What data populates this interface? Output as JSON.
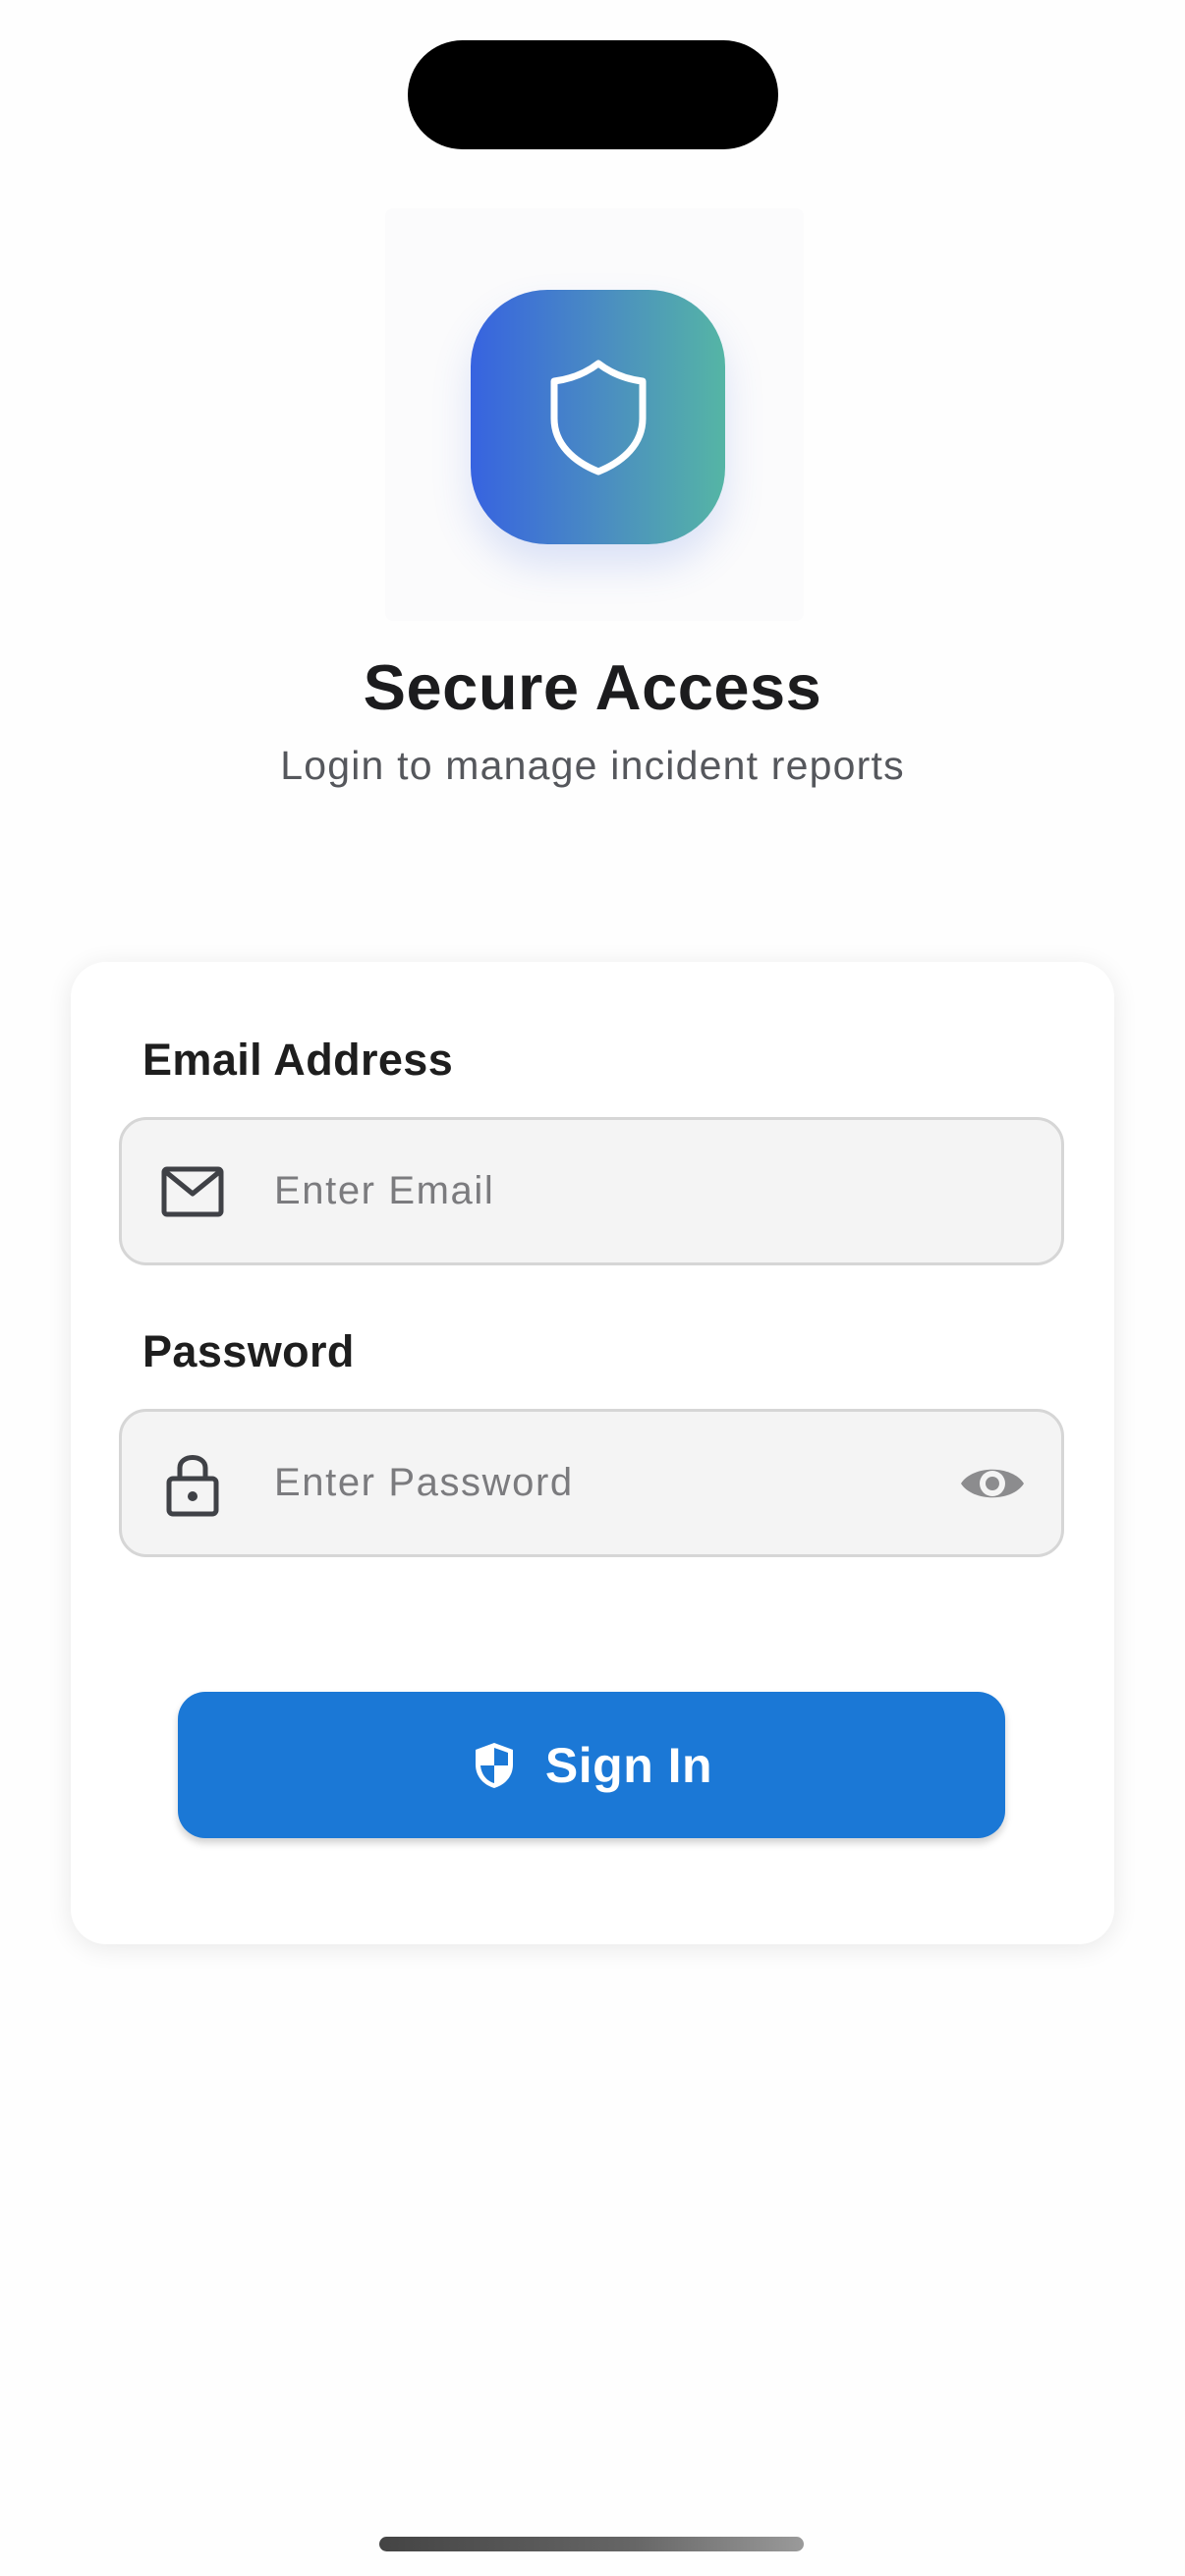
{
  "app": {
    "title": "Secure Access",
    "subtitle": "Login to manage incident reports"
  },
  "logo": {
    "icon": "shield-outline-icon",
    "gradient": [
      "#3763e0",
      "#55b5a5"
    ]
  },
  "form": {
    "email": {
      "label": "Email Address",
      "placeholder": "Enter Email",
      "value": "",
      "icon": "envelope-icon"
    },
    "password": {
      "label": "Password",
      "placeholder": "Enter Password",
      "value": "",
      "icon": "lock-icon",
      "toggle_icon": "eye-icon"
    },
    "submit": {
      "label": "Sign In",
      "icon": "shield-half-icon"
    }
  },
  "colors": {
    "primary": "#1b78d6",
    "title_text": "#1c1c1e",
    "subtitle_text": "#55575c",
    "input_bg": "#f4f4f4",
    "input_border": "#d6d6d6"
  }
}
